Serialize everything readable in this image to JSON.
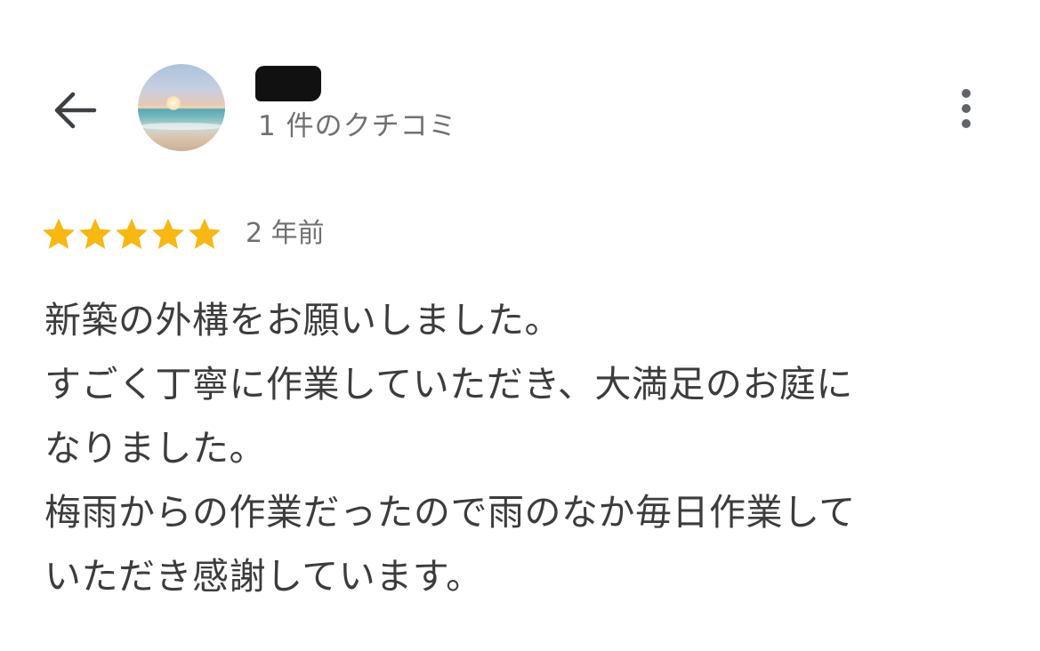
{
  "header": {
    "back_icon": "arrow-back-icon",
    "avatar_icon": "beach-sunset-avatar",
    "reviewer_name": "",
    "review_count": "1 件のクチコミ",
    "more_icon": "more-vertical-icon"
  },
  "review": {
    "rating": 5,
    "rating_max": 5,
    "star_color": "#f8b812",
    "time_ago": "2 年前",
    "lines": [
      "新築の外構をお願いしました。",
      "すごく丁寧に作業していただき、大満足のお庭に",
      "なりました。",
      "梅雨からの作業だったので雨のなか毎日作業して",
      "いただき感謝しています。"
    ]
  }
}
